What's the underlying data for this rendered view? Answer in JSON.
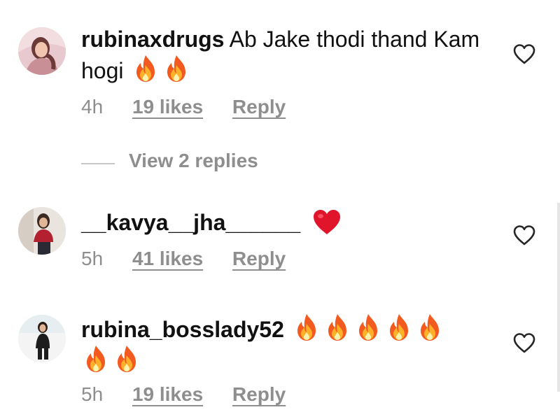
{
  "comments": [
    {
      "username": "rubinaxdrugs",
      "text": "Ab Jake thodi thand Kam hogi",
      "emoji": [
        "fire-emoji",
        "fire-emoji"
      ],
      "time": "4h",
      "likes": "19 likes",
      "reply": "Reply",
      "like_icon": "heart-outline-icon"
    },
    {
      "username": "__kavya__jha______",
      "text": "",
      "emoji": [
        "red-heart-emoji"
      ],
      "time": "5h",
      "likes": "41 likes",
      "reply": "Reply",
      "like_icon": "heart-outline-icon"
    },
    {
      "username": "rubina_bosslady52",
      "text": "",
      "emoji": [
        "fire-emoji",
        "fire-emoji",
        "fire-emoji",
        "fire-emoji",
        "fire-emoji",
        "fire-emoji",
        "fire-emoji"
      ],
      "time": "5h",
      "likes": "19 likes",
      "reply": "Reply",
      "like_icon": "heart-outline-icon"
    }
  ],
  "view_replies": "View 2 replies",
  "colors": {
    "text": "#111111",
    "meta": "#8e8e8e",
    "heart_red": "#e0142b",
    "fire_orange": "#f57c00"
  }
}
